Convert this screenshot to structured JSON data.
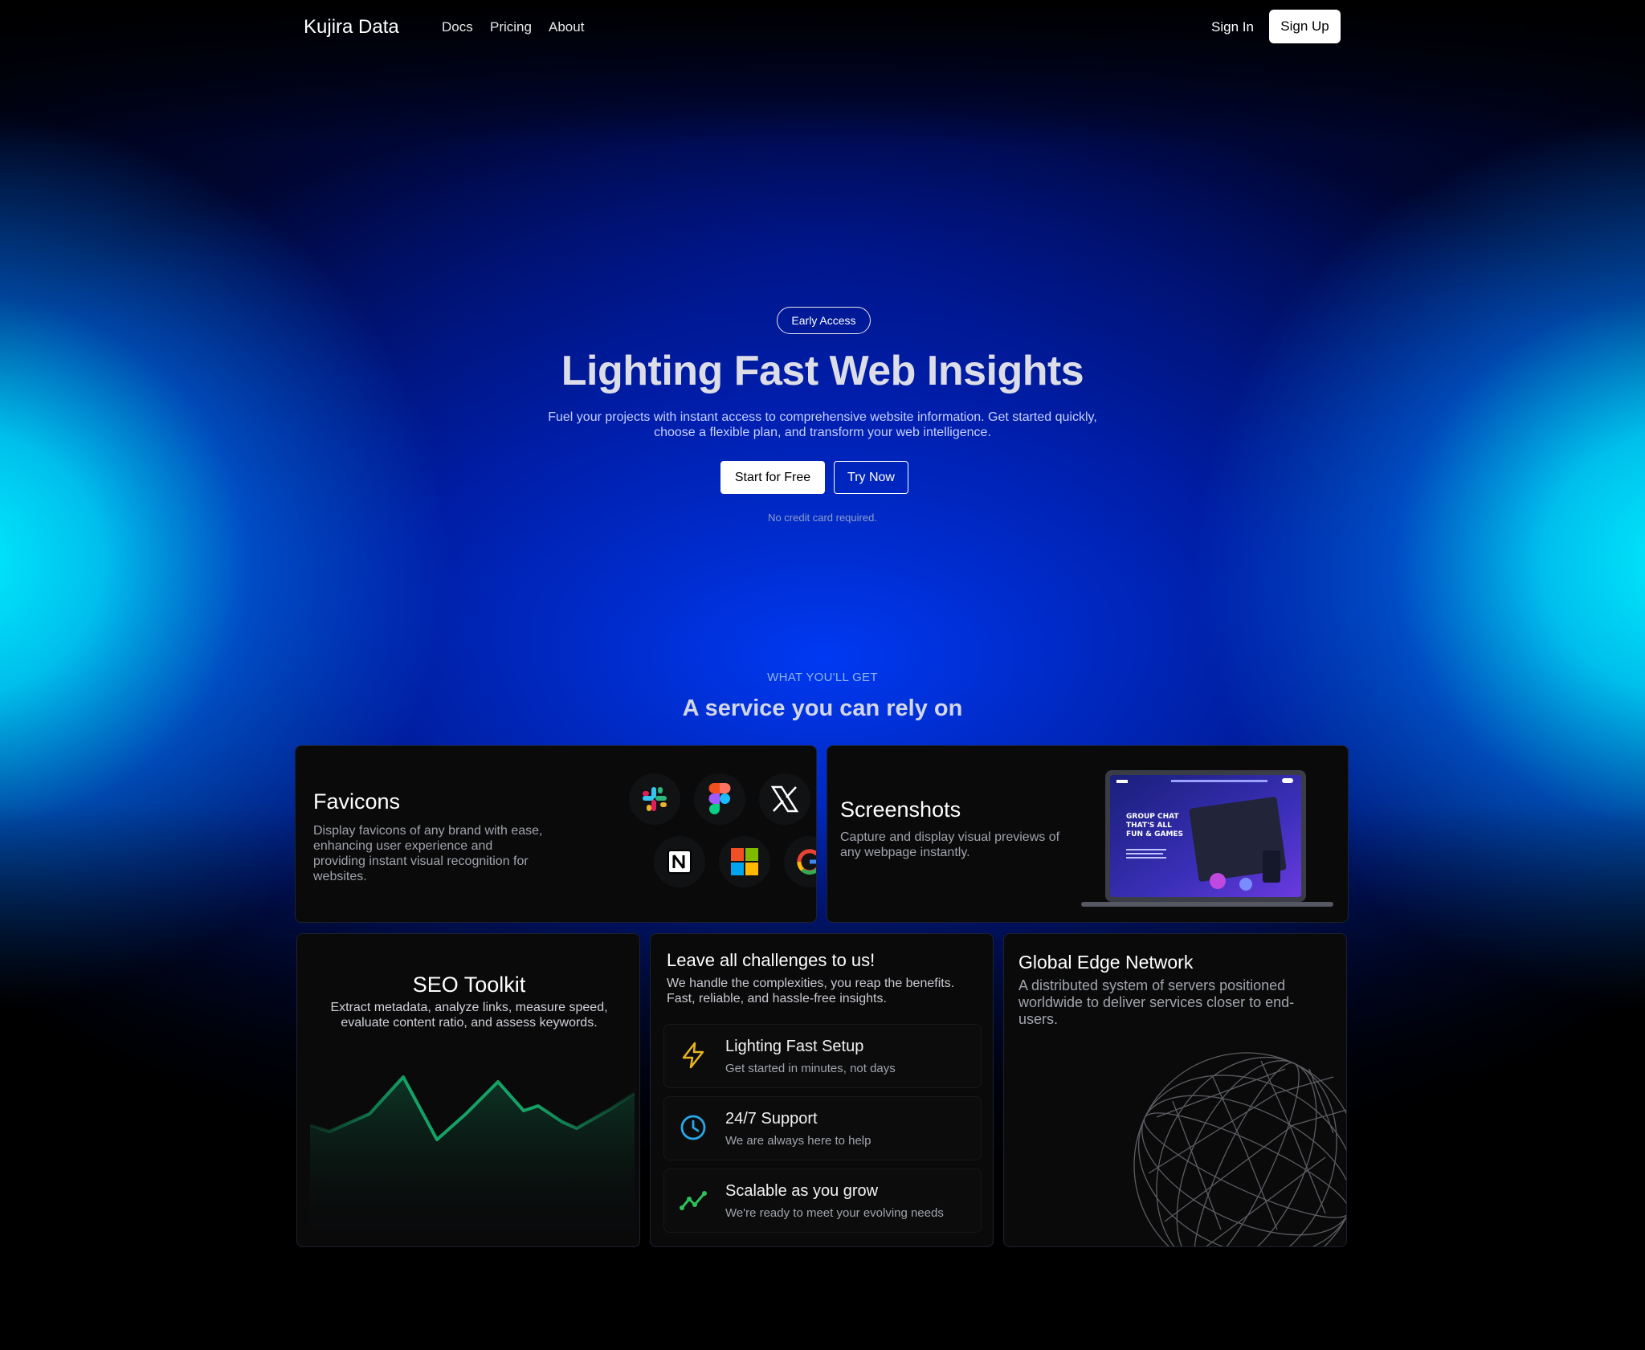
{
  "nav": {
    "brand": "Kujira Data",
    "links": [
      "Docs",
      "Pricing",
      "About"
    ],
    "sign_in": "Sign In",
    "sign_up": "Sign Up"
  },
  "hero": {
    "badge": "Early Access",
    "title": "Lighting Fast Web Insights",
    "subtitle_line1": "Fuel your projects with instant access to comprehensive website information. Get started quickly,",
    "subtitle_line2": "choose a flexible plan, and transform your web intelligence.",
    "primary_cta": "Start for Free",
    "secondary_cta": "Try Now",
    "note": "No credit card required."
  },
  "section": {
    "eyebrow": "WHAT YOU'LL GET",
    "title": "A service you can rely on"
  },
  "cards": {
    "favicons": {
      "title": "Favicons",
      "description": "Display favicons of any brand with ease, enhancing user experience and providing instant visual recognition for websites.",
      "icons": [
        "slack-icon",
        "figma-icon",
        "x-icon",
        "notion-icon",
        "microsoft-icon",
        "google-icon"
      ]
    },
    "screenshots": {
      "title": "Screenshots",
      "description": "Capture and display visual previews of any webpage instantly.",
      "preview_headline": "GROUP CHAT THAT'S ALL FUN & GAMES"
    },
    "seo": {
      "title": "SEO Toolkit",
      "description": "Extract metadata, analyze links, measure speed, evaluate content ratio, and assess keywords."
    },
    "challenges": {
      "title": "Leave all challenges to us!",
      "description": "We handle the complexities, you reap the benefits. Fast, reliable, and hassle-free insights.",
      "features": [
        {
          "title": "Lighting Fast Setup",
          "description": "Get started in minutes, not days",
          "icon": "lightning-icon",
          "color": "#e8b520"
        },
        {
          "title": "24/7 Support",
          "description": "We are always here to help",
          "icon": "clock-icon",
          "color": "#2aa7e6"
        },
        {
          "title": "Scalable as you grow",
          "description": "We're ready to meet your evolving needs",
          "icon": "trend-up-icon",
          "color": "#2fbf5a"
        }
      ]
    },
    "edge": {
      "title": "Global Edge Network",
      "description": "A distributed system of servers positioned worldwide to deliver services closer to end-users."
    }
  },
  "colors": {
    "glow_cyan": "#00f0ff",
    "glow_blue": "#0038ff",
    "card_bg": "#0a0a0b",
    "chart_green": "#17c47a"
  }
}
